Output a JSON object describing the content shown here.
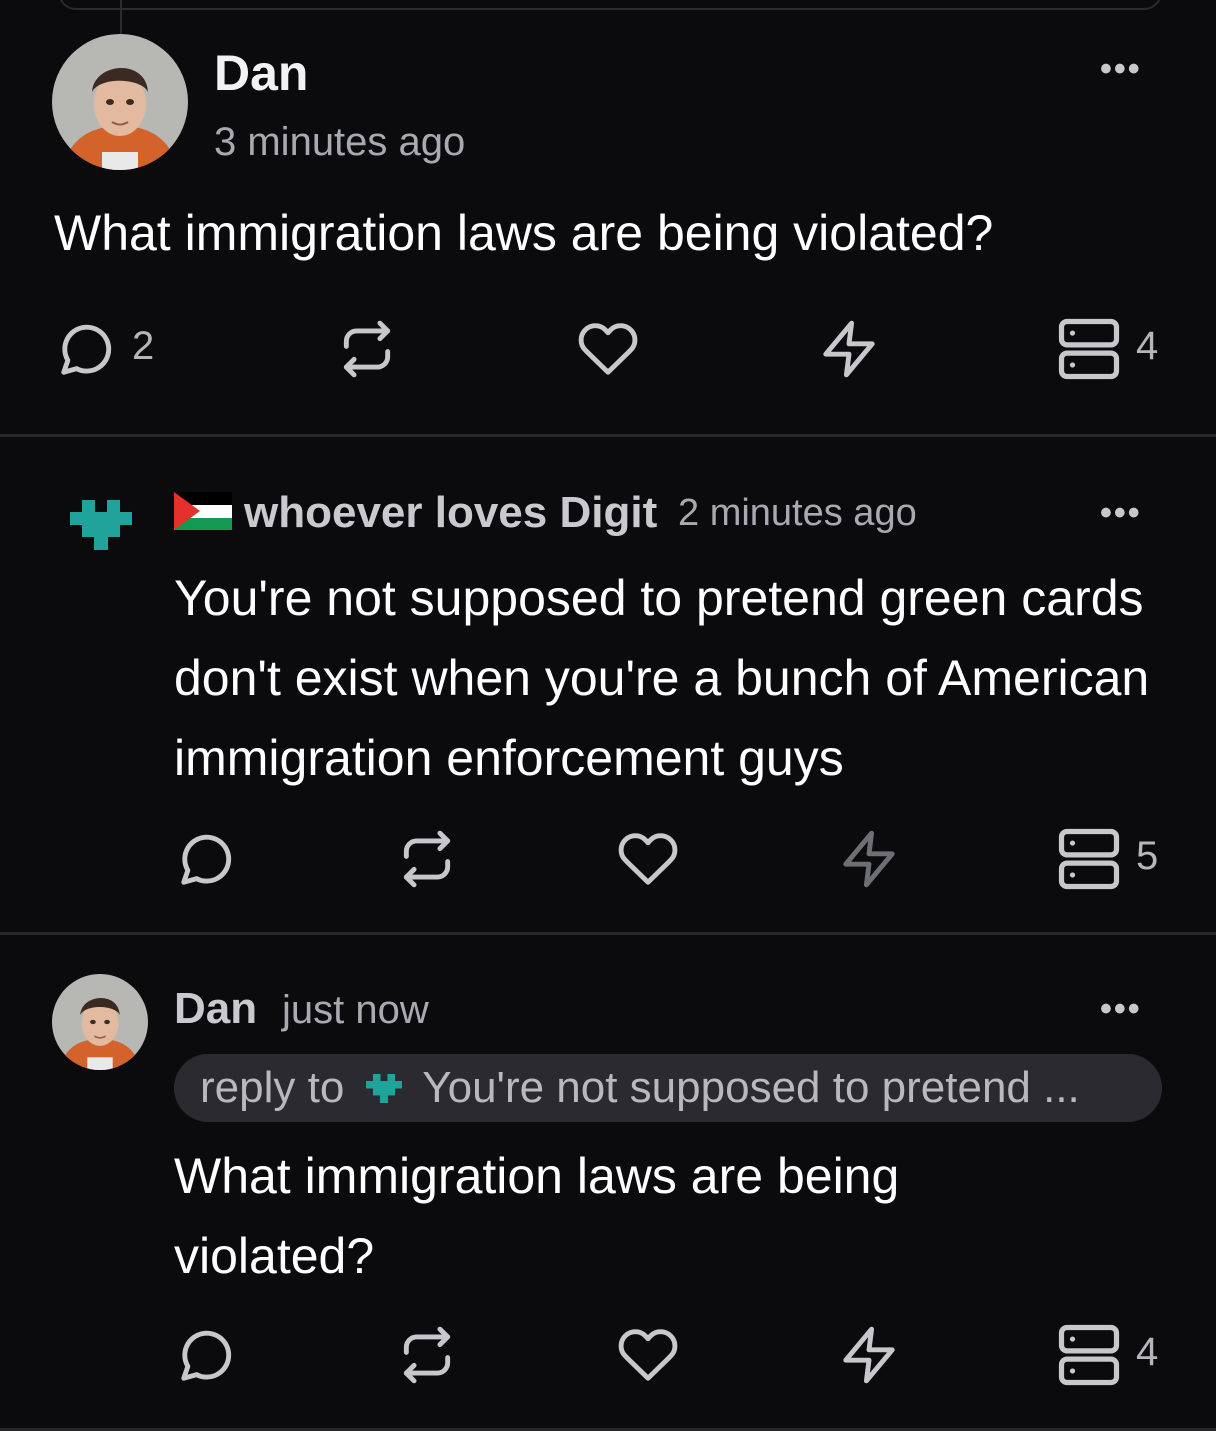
{
  "posts": [
    {
      "author": "Dan",
      "time": "3 minutes ago",
      "content": "What immigration laws are being violated?",
      "more": "•••",
      "reply_count": "2",
      "zap_count": "4"
    },
    {
      "author": "whoever loves Digit",
      "time": "2 minutes ago",
      "content": "You're not supposed to pretend green cards don't exist when you're a bunch of American immigration enforcement guys",
      "more": "•••",
      "zap_count": "5"
    },
    {
      "author": "Dan",
      "time": "just now",
      "reply_label": "reply to",
      "reply_preview": "You're not supposed to pretend ...",
      "content": "What immigration laws are being violated?",
      "more": "•••",
      "zap_count": "4"
    }
  ],
  "colors": {
    "background": "#0b0b0e",
    "divider": "#26262b",
    "accent_teal": "#1fa39a",
    "icon": "#c7c7cc"
  },
  "icons": [
    "comment-icon",
    "repost-icon",
    "heart-icon",
    "lightning-icon",
    "stack-icon",
    "more-icon",
    "avatar",
    "pixel-heart-icon",
    "palestine-flag-icon"
  ]
}
